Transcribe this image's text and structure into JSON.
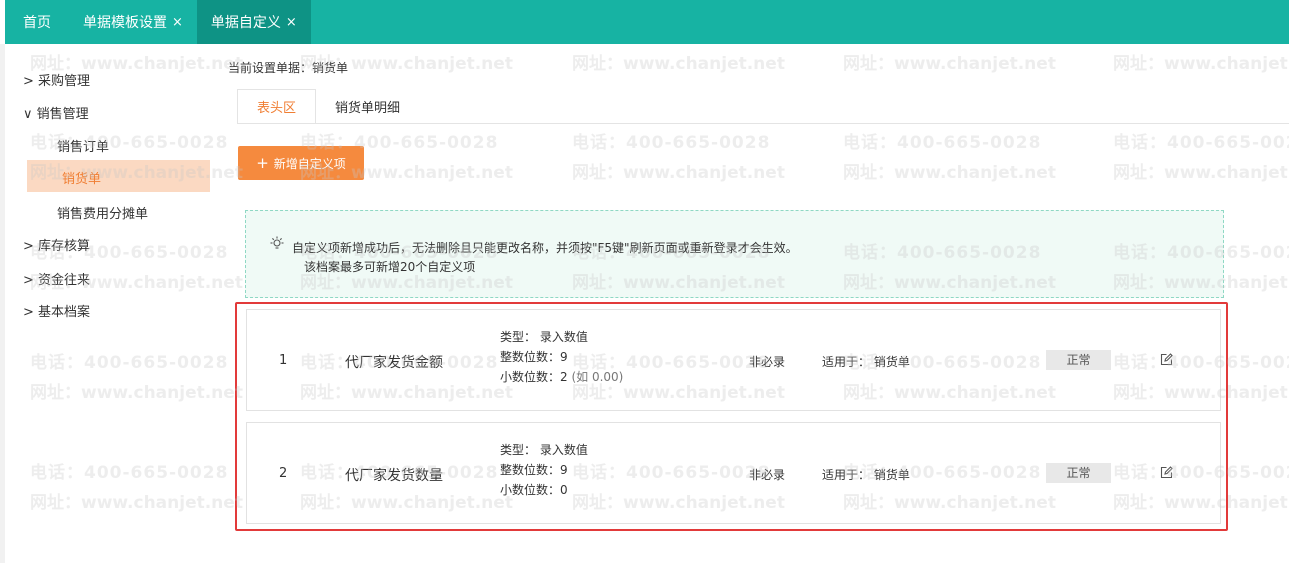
{
  "topbar": {
    "tabs": [
      {
        "label": "首页",
        "closable": false
      },
      {
        "label": "单据模板设置",
        "closable": true
      },
      {
        "label": "单据自定义",
        "closable": true,
        "active": true
      }
    ],
    "close_glyph": "×",
    "color": "#17b3a3"
  },
  "watermark": {
    "phone": "电话：400-665-0028",
    "site": "网址：www.chanjet.net"
  },
  "sidebar": {
    "groups": [
      {
        "label": "采购管理",
        "arrow": ">"
      },
      {
        "label": "销售管理",
        "arrow": "∨",
        "children": [
          "销售订单",
          "销货单",
          "销售费用分摊单"
        ],
        "active_child": "销货单"
      },
      {
        "label": "库存核算",
        "arrow": ">"
      },
      {
        "label": "资金往来",
        "arrow": ">"
      },
      {
        "label": "基本档案",
        "arrow": ">"
      }
    ]
  },
  "main": {
    "current_doc": "当前设置单据：销货单",
    "subtabs": [
      {
        "label": "表头区",
        "active": true
      },
      {
        "label": "销货单明细",
        "active": false
      }
    ],
    "add_button": "新增自定义项",
    "notice_line1": "自定义项新增成功后，无法删除且只能更改名称，并须按\"F5键\"刷新页面或重新登录才会生效。",
    "notice_line2": "该档案最多可新增20个自定义项",
    "items": [
      {
        "index": "1",
        "name": "代厂家发货金额",
        "type": "类型： 录入数值",
        "int_digits": "整数位数：9",
        "dec_digits": "小数位数：2",
        "dec_hint": "(如 0.00)",
        "required": "非必录",
        "applies": "适用于：  销货单",
        "status": "正常"
      },
      {
        "index": "2",
        "name": "代厂家发货数量",
        "type": "类型： 录入数值",
        "int_digits": "整数位数：9",
        "dec_digits": "小数位数：0",
        "dec_hint": "",
        "required": "非必录",
        "applies": "适用于：  销货单",
        "status": "正常"
      }
    ],
    "accent": "#f58a3e",
    "highlight_color": "#e23a3a"
  }
}
